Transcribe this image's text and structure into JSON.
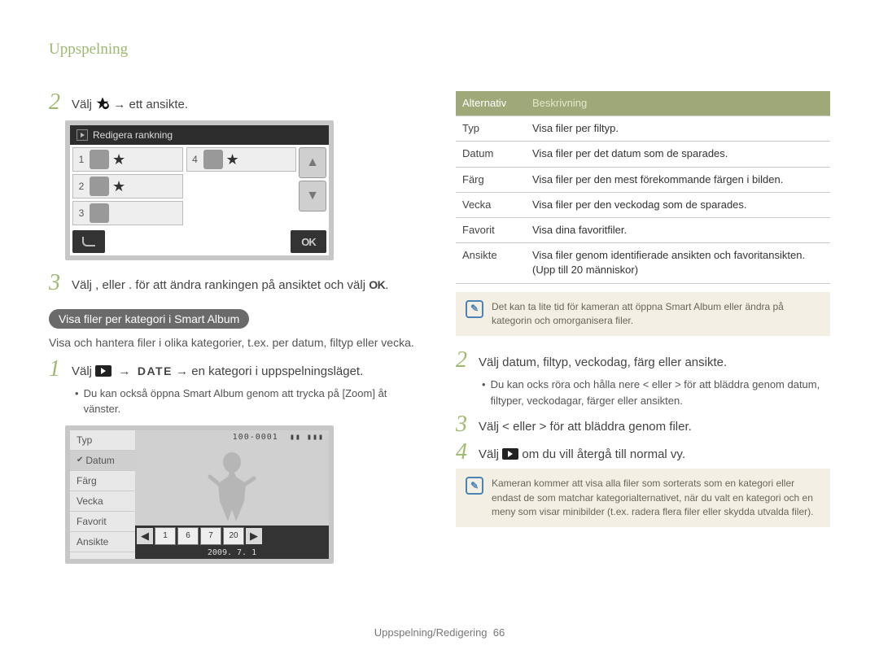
{
  "page_header": "Uppspelning",
  "left": {
    "step2": {
      "num": "2",
      "text_before": "Välj ",
      "text_after": " → ett ansikte."
    },
    "rank_screen": {
      "title": "Redigera rankning",
      "rows_left": [
        {
          "num": "1",
          "star": "★"
        },
        {
          "num": "2",
          "star": "★"
        },
        {
          "num": "3",
          "star": ""
        }
      ],
      "rows_right": [
        {
          "num": "4",
          "star": "★"
        },
        {
          "num": "",
          "star": ""
        },
        {
          "num": "",
          "star": ""
        }
      ],
      "btn_ok": "OK"
    },
    "step3": {
      "num": "3",
      "text": "Välj ,      eller .      för att ändra rankingen på ansiktet och välj "
    },
    "subhead": "Visa filer per kategori i Smart Album",
    "desc": "Visa och hantera filer i olika kategorier, t.ex. per datum, filtyp eller vecka.",
    "step1": {
      "num": "1",
      "text_before": "Välj ",
      "text_after": " → en kategori i uppspelningsläget."
    },
    "bullet1": "Du kan också öppna Smart Album genom att trycka på [Zoom] åt vänster.",
    "date_label": "DATE",
    "album_screen": {
      "menu": [
        "Typ",
        "Datum",
        "Färg",
        "Vecka",
        "Favorit",
        "Ansikte"
      ],
      "selected_index": 1,
      "topstat": "100-0001",
      "thumbs": [
        "1",
        "6",
        "7",
        "20"
      ],
      "date": "2009. 7. 1"
    }
  },
  "right": {
    "table": {
      "head": [
        "Alternativ",
        "Beskrivning"
      ],
      "rows": [
        [
          "Typ",
          "Visa filer per filtyp."
        ],
        [
          "Datum",
          "Visa filer per det datum som de sparades."
        ],
        [
          "Färg",
          "Visa filer per den mest förekommande färgen i bilden."
        ],
        [
          "Vecka",
          "Visa filer per den veckodag som de sparades."
        ],
        [
          "Favorit",
          "Visa dina favoritfiler."
        ],
        [
          "Ansikte",
          "Visa filer genom identifierade ansikten och favoritansikten. (Upp till 20 människor)"
        ]
      ]
    },
    "note1": "Det kan ta lite tid för kameran att öppna Smart Album eller ändra på kategorin och omorganisera filer.",
    "step2": {
      "num": "2",
      "text": "Välj datum, filtyp, veckodag, färg eller ansikte."
    },
    "bullet2": "Du kan ocks röra och hålla nere  <  eller  >   för att bläddra genom datum, filtyper, veckodagar, färger eller ansikten.",
    "step3": {
      "num": "3",
      "text": "Välj  <  eller  >   för att bläddra genom filer."
    },
    "step4": {
      "num": "4",
      "text_before": "Välj ",
      "text_after": " om du vill återgå till normal vy."
    },
    "note2": "Kameran kommer att visa alla filer som sorterats som en kategori eller endast de som matchar kategorialternativet, när du valt en kategori och en meny som visar minibilder (t.ex. radera flera filer eller skydda utvalda filer)."
  },
  "footer": {
    "label": "Uppspelning/Redigering",
    "page": "66"
  }
}
